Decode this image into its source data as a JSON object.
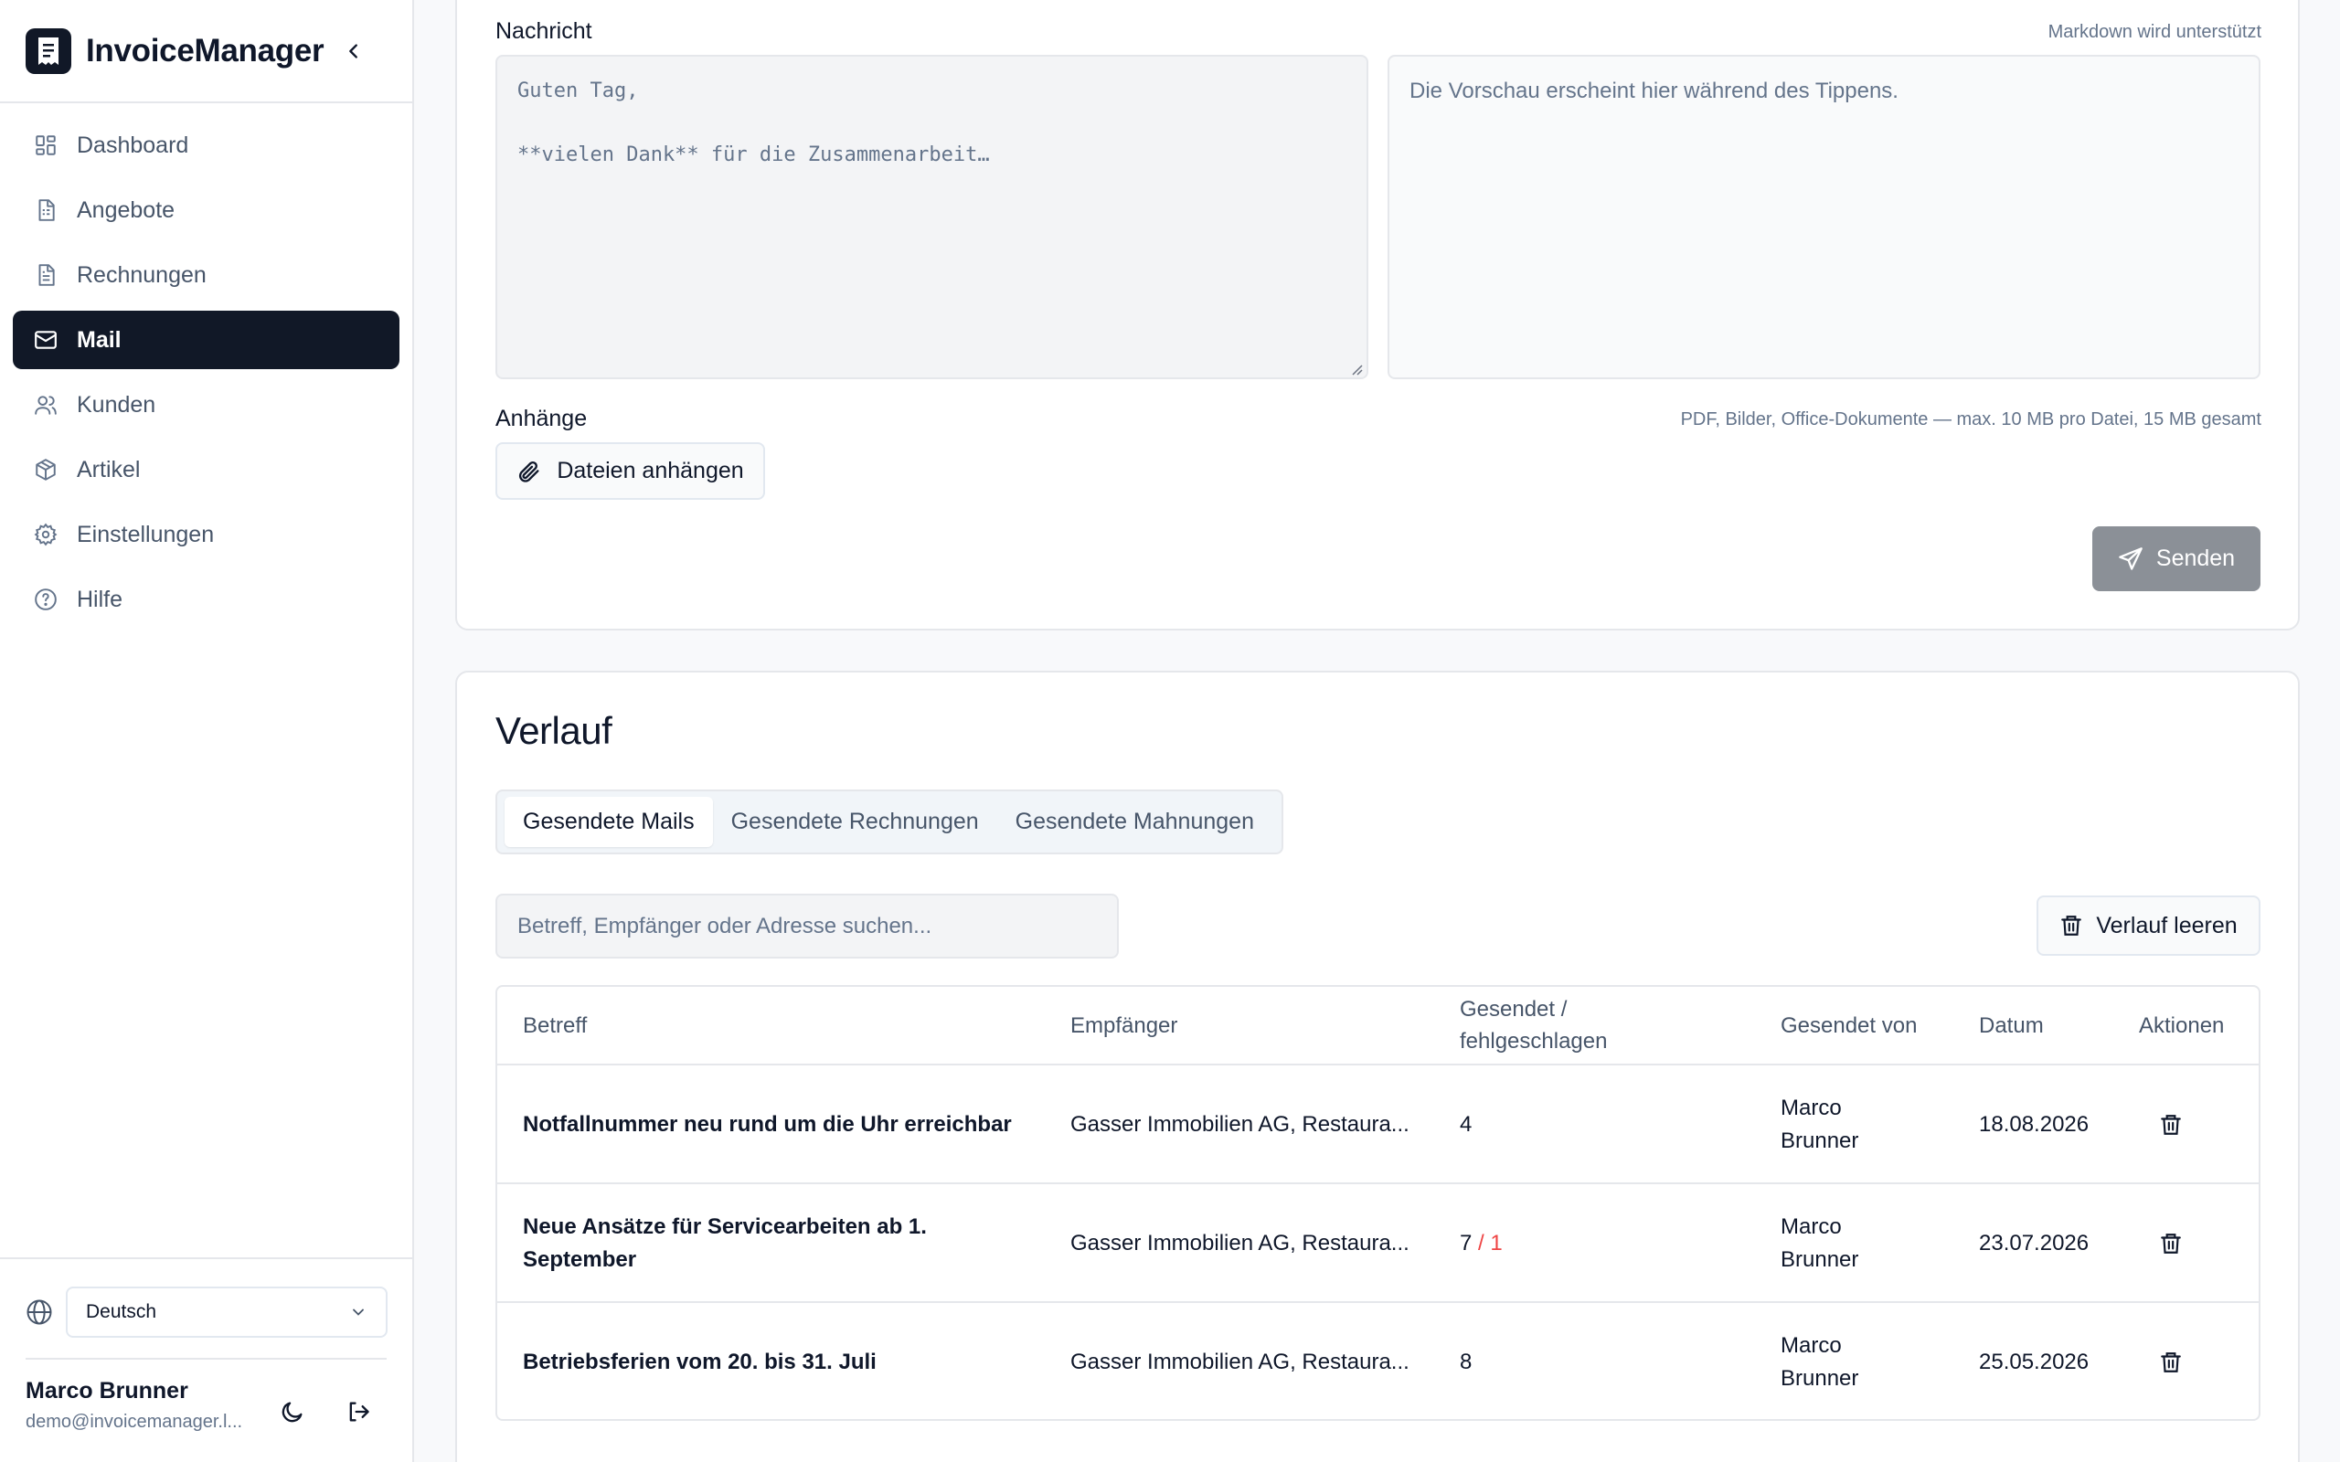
{
  "app": {
    "title": "InvoiceManager"
  },
  "sidebar": {
    "items": [
      {
        "label": "Dashboard",
        "icon": "dashboard-icon"
      },
      {
        "label": "Angebote",
        "icon": "quote-document-icon"
      },
      {
        "label": "Rechnungen",
        "icon": "invoice-document-icon"
      },
      {
        "label": "Mail",
        "icon": "mail-icon",
        "active": true
      },
      {
        "label": "Kunden",
        "icon": "users-icon"
      },
      {
        "label": "Artikel",
        "icon": "package-icon"
      },
      {
        "label": "Einstellungen",
        "icon": "gear-icon"
      },
      {
        "label": "Hilfe",
        "icon": "help-circle-icon"
      }
    ],
    "language": {
      "selected": "Deutsch"
    },
    "user": {
      "name": "Marco Brunner",
      "email": "demo@invoicemanager.l..."
    }
  },
  "compose": {
    "message_label": "Nachricht",
    "markdown_hint": "Markdown wird unterstützt",
    "message_value": "Guten Tag,\n\n**vielen Dank** für die Zusammenarbeit…",
    "preview_placeholder": "Die Vorschau erscheint hier während des Tippens.",
    "attachments_label": "Anhänge",
    "attachments_hint": "PDF, Bilder, Office-Dokumente — max. 10 MB pro Datei, 15 MB gesamt",
    "attach_button": "Dateien anhängen",
    "send_button": "Senden"
  },
  "history": {
    "title": "Verlauf",
    "tabs": [
      {
        "label": "Gesendete Mails",
        "active": true
      },
      {
        "label": "Gesendete Rechnungen",
        "active": false
      },
      {
        "label": "Gesendete Mahnungen",
        "active": false
      }
    ],
    "search_placeholder": "Betreff, Empfänger oder Adresse suchen...",
    "clear_button": "Verlauf leeren",
    "columns": {
      "subject": "Betreff",
      "recipient": "Empfänger",
      "sent_failed_1": "Gesendet /",
      "sent_failed_2": "fehlgeschlagen",
      "sent_by": "Gesendet von",
      "date": "Datum",
      "actions": "Aktionen"
    },
    "rows": [
      {
        "subject_1": "Notfallnummer neu rund um die Uhr erreichbar",
        "subject_2": "",
        "recipient": "Gasser Immobilien AG, Restaura...",
        "sent": "4",
        "failed": "",
        "sent_by_1": "Marco",
        "sent_by_2": "Brunner",
        "date": "18.08.2026"
      },
      {
        "subject_1": "Neue Ansätze für Servicearbeiten ab 1.",
        "subject_2": "September",
        "recipient": "Gasser Immobilien AG, Restaura...",
        "sent": "7",
        "failed": " / 1",
        "sent_by_1": "Marco",
        "sent_by_2": "Brunner",
        "date": "23.07.2026"
      },
      {
        "subject_1": "Betriebsferien vom 20. bis 31. Juli",
        "subject_2": "",
        "recipient": "Gasser Immobilien AG, Restaura...",
        "sent": "8",
        "failed": "",
        "sent_by_1": "Marco",
        "sent_by_2": "Brunner",
        "date": "25.05.2026"
      }
    ]
  },
  "colors": {
    "primary_dark": "#111827",
    "send_button_disabled": "#8b9097",
    "failed_red": "#ef4444",
    "muted_text": "#64748b"
  }
}
